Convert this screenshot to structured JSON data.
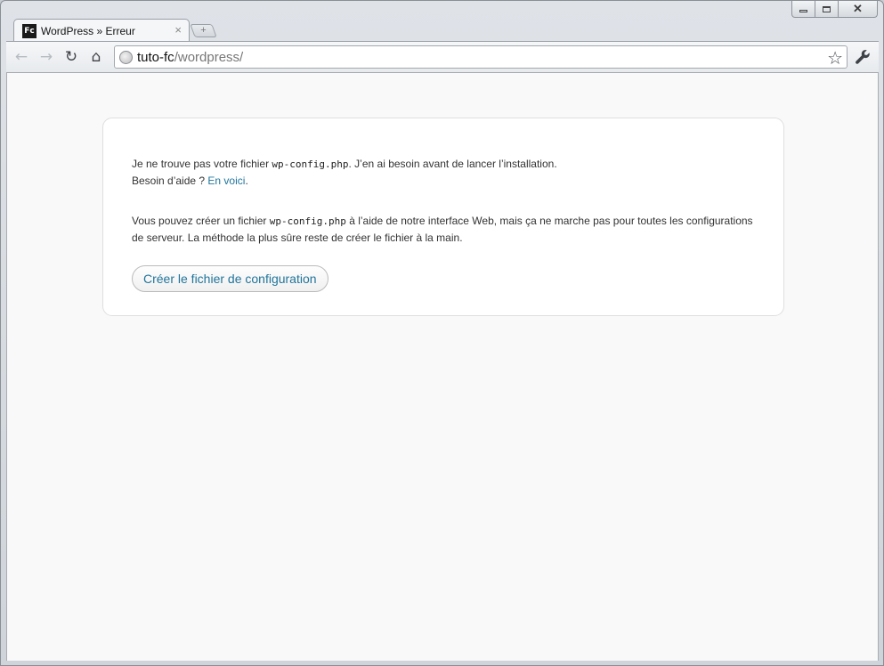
{
  "browser": {
    "tab": {
      "favicon_text": "Fc",
      "title": "WordPress » Erreur",
      "close_glyph": "×"
    },
    "new_tab_glyph": "+",
    "window_controls": {
      "close_glyph": "✕"
    },
    "toolbar": {
      "back_icon": "←",
      "forward_icon": "→",
      "reload_icon": "↻",
      "home_icon": "⌂",
      "url_host": "tuto-fc",
      "url_path": "/wordpress/",
      "star_icon": "☆"
    }
  },
  "page": {
    "para1_before_code": "Je ne trouve pas votre fichier ",
    "para1_code": "wp-config.php",
    "para1_after_code": ". J’en ai besoin avant de lancer l’installation.",
    "para1_help_text": "Besoin d’aide ? ",
    "para1_link": "En voici",
    "para1_link_suffix": ".",
    "para2_before_code": "Vous pouvez créer un fichier ",
    "para2_code": "wp-config.php",
    "para2_after_code": " à l’aide de notre interface Web, mais ça ne marche pas pour toutes les configurations de serveur. La méthode la plus sûre reste de créer le fichier à la main.",
    "create_button_label": "Créer le fichier de configuration"
  },
  "colors": {
    "link": "#21759b",
    "page_background": "#f9f9f9"
  }
}
